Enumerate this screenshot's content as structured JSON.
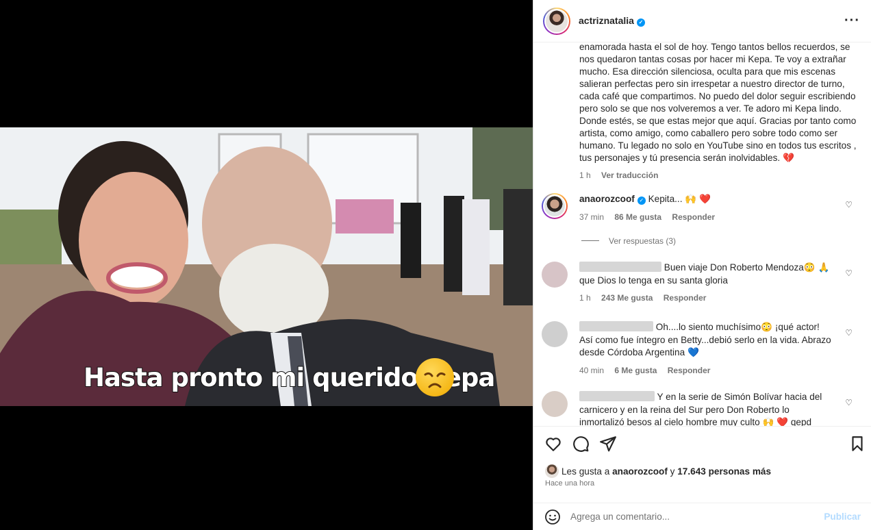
{
  "post": {
    "overlay_text": "Hasta pronto mi querido Kepa",
    "author": "actriznatalia",
    "caption": "enamorada hasta el sol de hoy. Tengo tantos bellos recuerdos, se nos quedaron tantas cosas por hacer mi Kepa. Te voy a extrañar mucho. Esa dirección silenciosa, oculta para que mis escenas salieran perfectas pero sin irrespetar a nuestro director de turno, cada café que compartimos. No puedo del dolor seguir escribiendo pero solo se que nos volveremos a ver. Te adoro mi Kepa lindo. Donde estés, se que estas mejor que aquí. Gracias por tanto como artista, como amigo, como caballero pero sobre todo como ser humano. Tu legado no solo en YouTube sino en todos tus escritos , tus personajes y tú presencia serán inolvidables. 💔",
    "caption_time": "1 h",
    "caption_translate": "Ver traducción"
  },
  "comments": [
    {
      "user": "anaorozcoof",
      "verified": true,
      "text": "Kepita... 🙌 ❤️",
      "time": "37 min",
      "likes": "86 Me gusta",
      "reply": "Responder",
      "view_replies": "Ver respuestas (3)"
    },
    {
      "user": "",
      "text": "Buen viaje Don Roberto Mendoza😳 🙏 que Dios lo tenga en su santa gloria",
      "time": "1 h",
      "likes": "243 Me gusta",
      "reply": "Responder"
    },
    {
      "user": "",
      "text": "Oh....lo siento muchísimo😳 ¡qué actor! Así como fue íntegro en Betty...debió serlo en la vida. Abrazo desde Córdoba Argentina 💙",
      "time": "40 min",
      "likes": "6 Me gusta",
      "reply": "Responder"
    },
    {
      "user": "",
      "text": "Y en la serie de Simón Bolívar hacia del carnicero y en la reina del Sur pero Don Roberto lo inmortalizó besos al cielo hombre muy culto 🙌 ❤️ qepd"
    }
  ],
  "likes_summary": {
    "prefix": "Les gusta a",
    "user": "anaorozcoof",
    "middle": "y",
    "count": "17.643 personas más"
  },
  "posted_time": "Hace una hora",
  "add_comment": {
    "placeholder": "Agrega un comentario...",
    "publish": "Publicar"
  },
  "colors": {
    "accent": "#0095f6",
    "publish_disabled": "#b3dbff",
    "secondary_text": "#737373"
  }
}
